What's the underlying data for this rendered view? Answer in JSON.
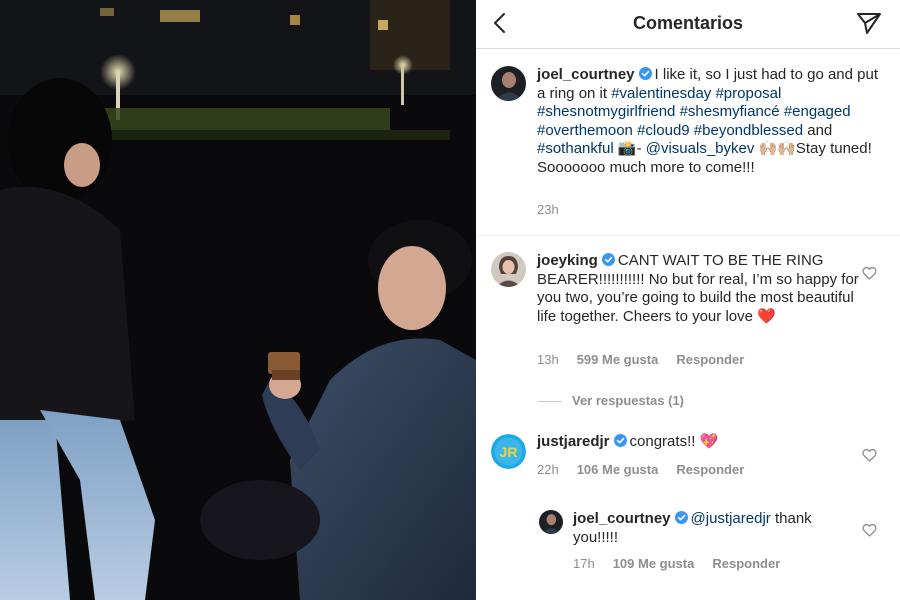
{
  "header": {
    "title": "Comentarios"
  },
  "caption": {
    "username": "joel_courtney",
    "segments": [
      {
        "type": "text",
        "text": "I like it, so I just had to go and put a ring on it "
      },
      {
        "type": "tag",
        "text": "#valentinesday"
      },
      {
        "type": "text",
        "text": " "
      },
      {
        "type": "tag",
        "text": "#proposal"
      },
      {
        "type": "text",
        "text": " "
      },
      {
        "type": "tag",
        "text": "#shesnotmygirlfriend"
      },
      {
        "type": "text",
        "text": " "
      },
      {
        "type": "tag",
        "text": "#shesmyfiancé"
      },
      {
        "type": "text",
        "text": " "
      },
      {
        "type": "tag",
        "text": "#engaged"
      },
      {
        "type": "text",
        "text": " "
      },
      {
        "type": "tag",
        "text": "#overthemoon"
      },
      {
        "type": "text",
        "text": " "
      },
      {
        "type": "tag",
        "text": "#cloud9"
      },
      {
        "type": "text",
        "text": " "
      },
      {
        "type": "tag",
        "text": "#beyondblessed"
      },
      {
        "type": "text",
        "text": " and "
      },
      {
        "type": "tag",
        "text": "#sothankful"
      },
      {
        "type": "text",
        "text": " 📸- "
      },
      {
        "type": "tag",
        "text": "@visuals_bykev"
      },
      {
        "type": "text",
        "text": " 🙌🏼🙌🏼Stay tuned! Sooooooo much more to come!!!"
      }
    ],
    "time": "23h"
  },
  "comments": [
    {
      "username": "joeyking",
      "text": "CANT WAIT TO BE THE RING BEARER!!!!!!!!!!! No but for real, I’m so happy for you two, you’re going to build the most beautiful life together. Cheers to your love ❤️",
      "time": "13h",
      "likes": "599 Me gusta",
      "reply_label": "Responder"
    },
    {
      "username": "justjaredjr",
      "text": "congrats!! 💖",
      "time": "22h",
      "likes": "106 Me gusta",
      "reply_label": "Responder"
    }
  ],
  "view_replies": "Ver respuestas (1)",
  "reply": {
    "username": "joel_courtney",
    "mention": "@justjaredjr",
    "text": " thank you!!!!!",
    "time": "17h",
    "likes": "109 Me gusta",
    "reply_label": "Responder"
  },
  "avatar_badge": "JR",
  "icons": {
    "back": "chevron-left-icon",
    "send": "paper-plane-icon",
    "verified": "verified-badge-icon",
    "like": "heart-outline-icon"
  },
  "colors": {
    "link": "#00376b",
    "verified": "#3897f0",
    "muted": "#8e8e8e",
    "jr_badge": "#1aa9e8"
  }
}
